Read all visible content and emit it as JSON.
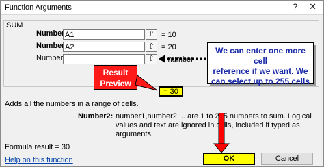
{
  "window": {
    "title": "Function Arguments",
    "help_glyph": "?",
    "close_glyph": "✕"
  },
  "group": {
    "label": "SUM"
  },
  "arguments": [
    {
      "label": "Number1",
      "value": "A1",
      "result": "=  10"
    },
    {
      "label": "Number2",
      "value": "A2",
      "result": "=  20"
    },
    {
      "label": "Number3",
      "value": "",
      "result": "=  number"
    }
  ],
  "collapse_glyph": "⇧",
  "annotations": {
    "callout_lines": [
      "We can enter one more cell",
      "reference if we want. We",
      "can select up to 255 cells"
    ],
    "badge_lines": [
      "Result",
      "Preview"
    ],
    "preview_value": "=  30",
    "colors": {
      "callout_text": "#1a2aa8",
      "badge": "#ff1a1a",
      "highlight": "#ffff00",
      "arrow_red": "#ff0000"
    }
  },
  "description": "Adds all the numbers in a range of cells.",
  "help": {
    "term": "Number2:",
    "text": "number1,number2,... are 1 to 255 numbers to sum. Logical values and text are ignored in cells, included if typed as arguments."
  },
  "formula_result": "Formula result =   30",
  "help_link": "Help on this function",
  "buttons": {
    "ok": "OK",
    "cancel": "Cancel"
  }
}
